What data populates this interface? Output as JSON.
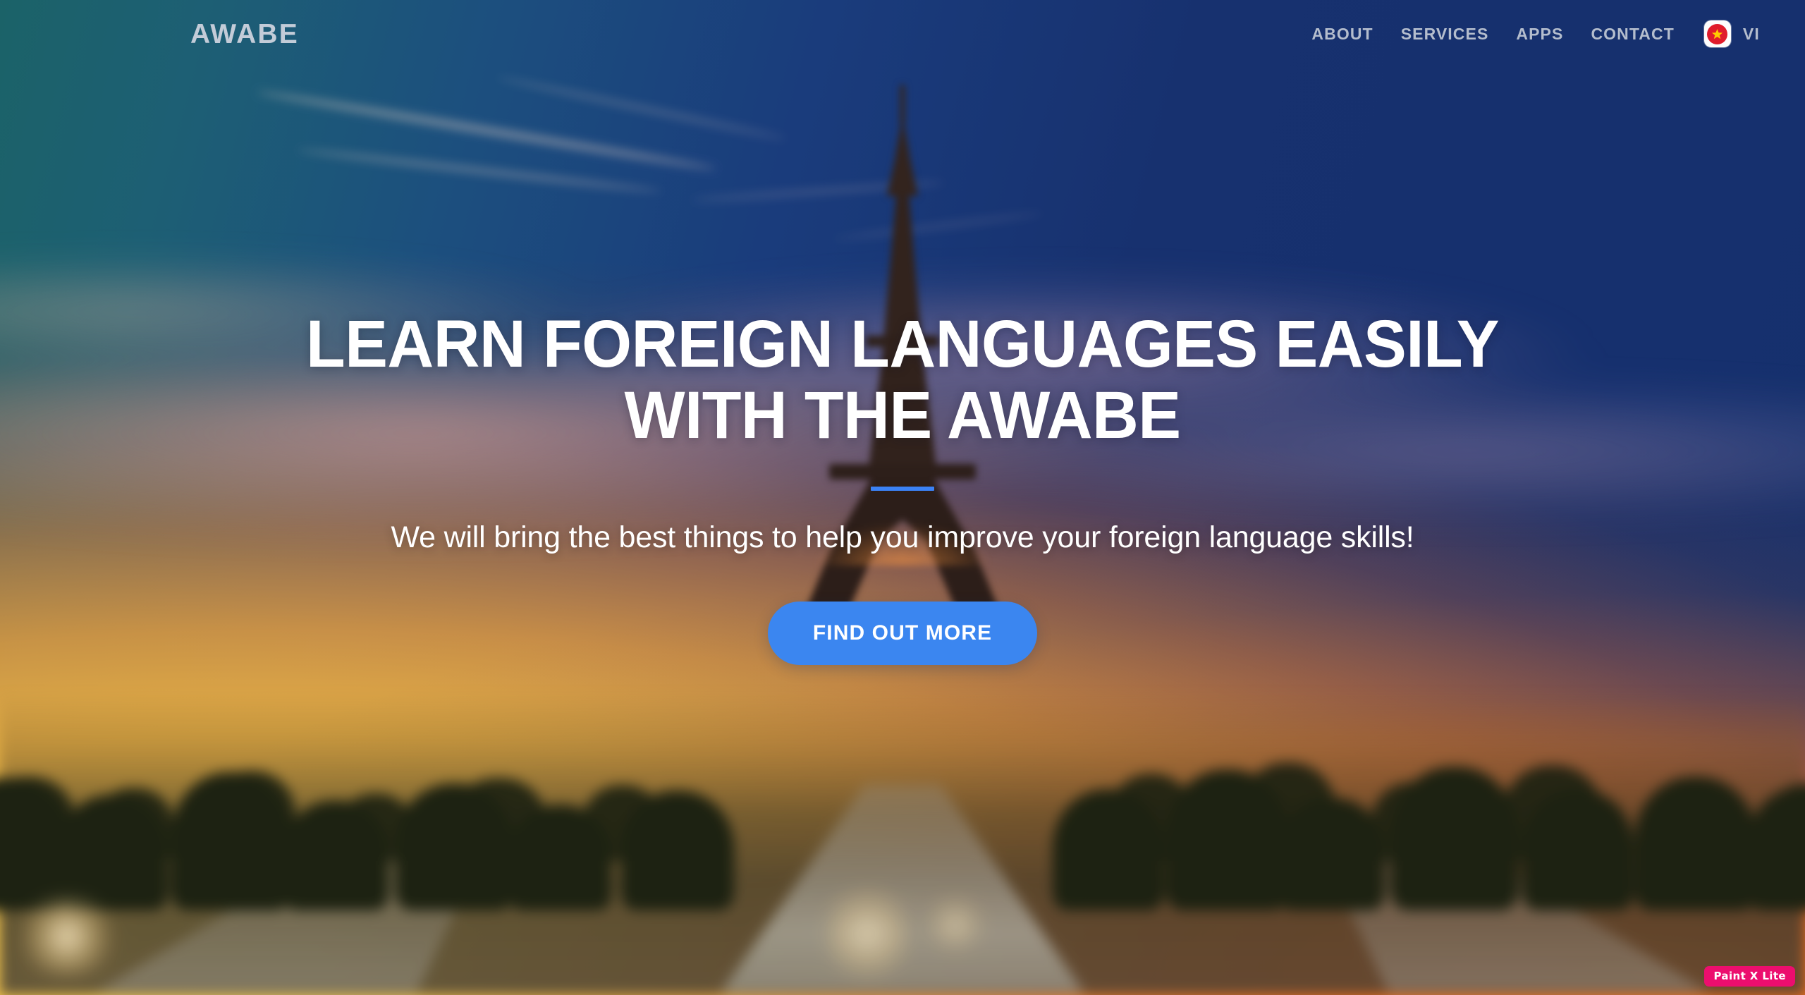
{
  "navbar": {
    "brand": "AWABE",
    "links": [
      {
        "label": "ABOUT",
        "name": "nav-link-about"
      },
      {
        "label": "SERVICES",
        "name": "nav-link-services"
      },
      {
        "label": "APPS",
        "name": "nav-link-apps"
      },
      {
        "label": "CONTACT",
        "name": "nav-link-contact"
      }
    ],
    "language": {
      "code": "VI",
      "flag_icon": "vietnam-flag-icon",
      "flag_field_color": "#e01b2b",
      "flag_star_color": "#ffcc00"
    },
    "link_color": "#b4bdcd",
    "brand_color": "#c3ccd8"
  },
  "hero": {
    "headline": "LEARN FOREIGN LANGUAGES EASILY WITH THE AWABE",
    "divider_color": "#3b82f6",
    "subheadline": "We will bring the best things to help you improve your foreign language skills!",
    "cta_label": "FIND OUT MORE",
    "cta_color": "#3b86f0",
    "headline_color": "#ffffff",
    "background_image": "blurred-eiffel-tower-sunset-paris"
  },
  "watermark": {
    "label": "Paint X Lite",
    "color": "#ec0e6e"
  }
}
